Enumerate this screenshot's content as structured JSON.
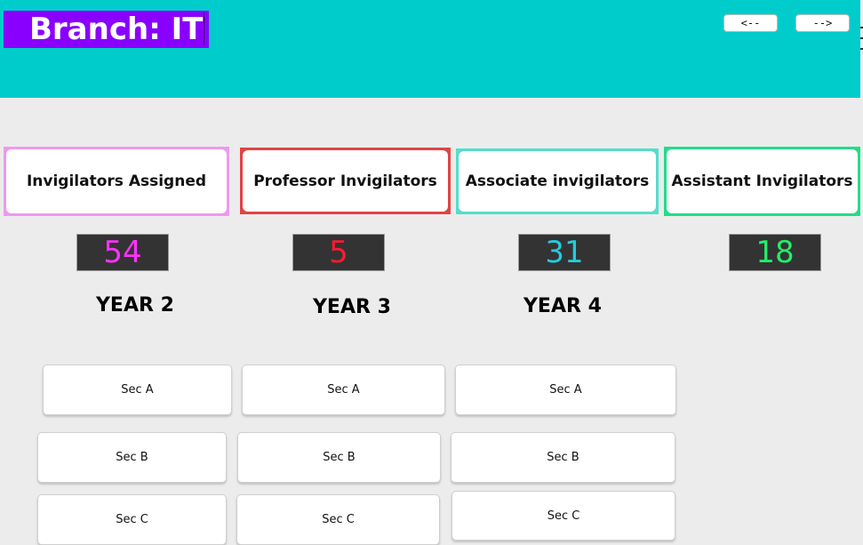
{
  "header": {
    "branch_label": "Branch: IT",
    "back_button": "<--",
    "forward_button": "-->",
    "background_color": "#00cccc",
    "branch_box_color": "#8a00ff"
  },
  "stats": [
    {
      "label": "Invigilators Assigned",
      "value": "54",
      "border_color": "#ee99ee",
      "value_color": "#ff33ff"
    },
    {
      "label": "Professor Invigilators",
      "value": "5",
      "border_color": "#e04444",
      "value_color": "#ff1a33"
    },
    {
      "label": "Associate invigilators",
      "value": "31",
      "border_color": "#55ddcc",
      "value_color": "#22ccdd"
    },
    {
      "label": "Assistant Invigilators",
      "value": "18",
      "border_color": "#22dd88",
      "value_color": "#22ee66"
    }
  ],
  "years": [
    {
      "label": "YEAR 2",
      "sections": [
        "Sec A",
        "Sec B",
        "Sec C"
      ]
    },
    {
      "label": "YEAR 3",
      "sections": [
        "Sec A",
        "Sec B",
        "Sec C"
      ]
    },
    {
      "label": "YEAR 4",
      "sections": [
        "Sec A",
        "Sec B",
        "Sec C"
      ]
    }
  ]
}
